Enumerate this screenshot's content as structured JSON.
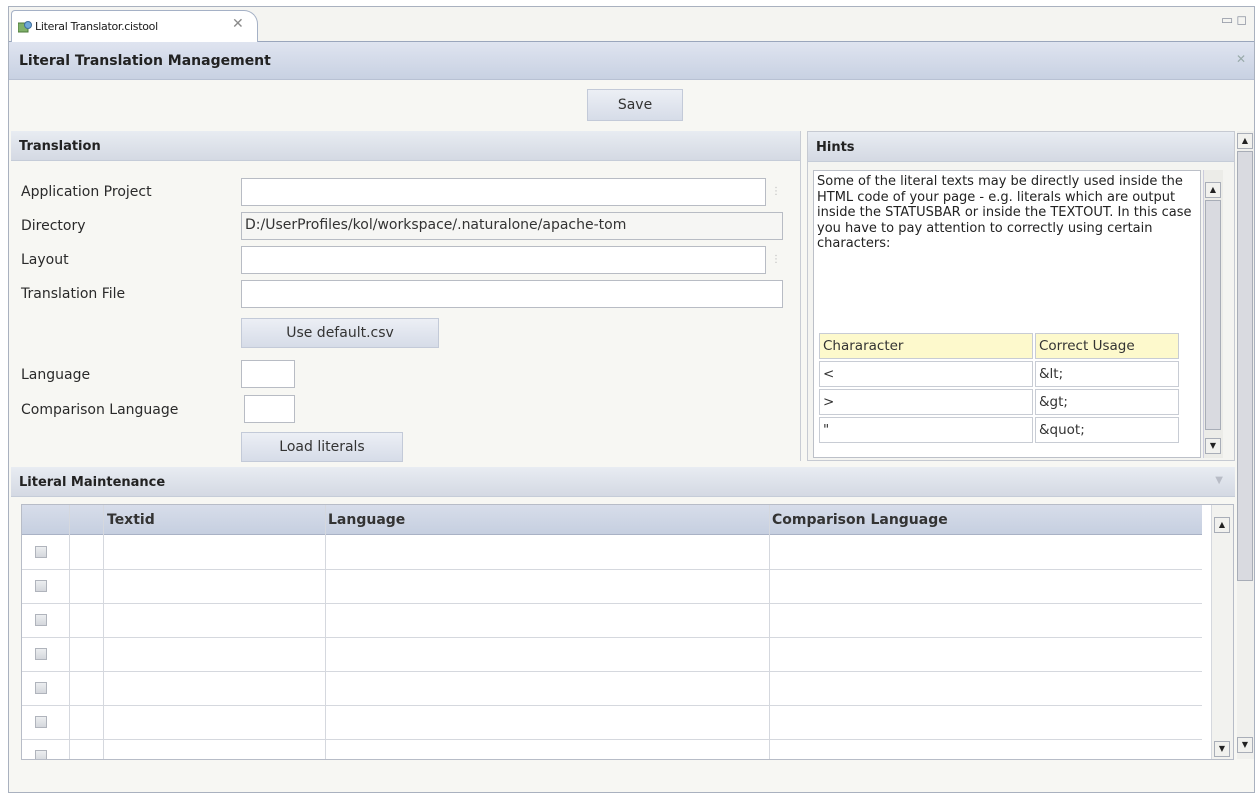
{
  "tab": {
    "label": "Literal Translator.cistool"
  },
  "page": {
    "title": "Literal Translation Management"
  },
  "toolbar": {
    "save_label": "Save"
  },
  "translation": {
    "heading": "Translation",
    "application_project_label": "Application Project",
    "application_project_value": "",
    "directory_label": "Directory",
    "directory_value": "D:/UserProfiles/kol/workspace/.naturalone/apache-tom",
    "layout_label": "Layout",
    "layout_value": "",
    "translation_file_label": "Translation File",
    "translation_file_value": "",
    "use_default_label": "Use default.csv",
    "language_label": "Language",
    "language_value": "",
    "comparison_language_label": "Comparison Language",
    "comparison_language_value": "",
    "load_literals_label": "Load literals"
  },
  "hints": {
    "heading": "Hints",
    "text": "Some of the literal texts may be directly used inside the HTML code of your page - e.g. literals which are output inside the STATUSBAR or inside the TEXTOUT. In this case you have to pay attention to correctly using certain  characters:",
    "table_headers": [
      "Chararacter",
      "Correct Usage"
    ],
    "rows": [
      {
        "character": "<",
        "usage": "&lt;"
      },
      {
        "character": ">",
        "usage": "&gt;"
      },
      {
        "character": "\"",
        "usage": "&quot;"
      }
    ]
  },
  "maintenance": {
    "heading": "Literal Maintenance",
    "columns": {
      "textid": "Textid",
      "language": "Language",
      "comparison": "Comparison Language"
    },
    "row_count": 7
  }
}
